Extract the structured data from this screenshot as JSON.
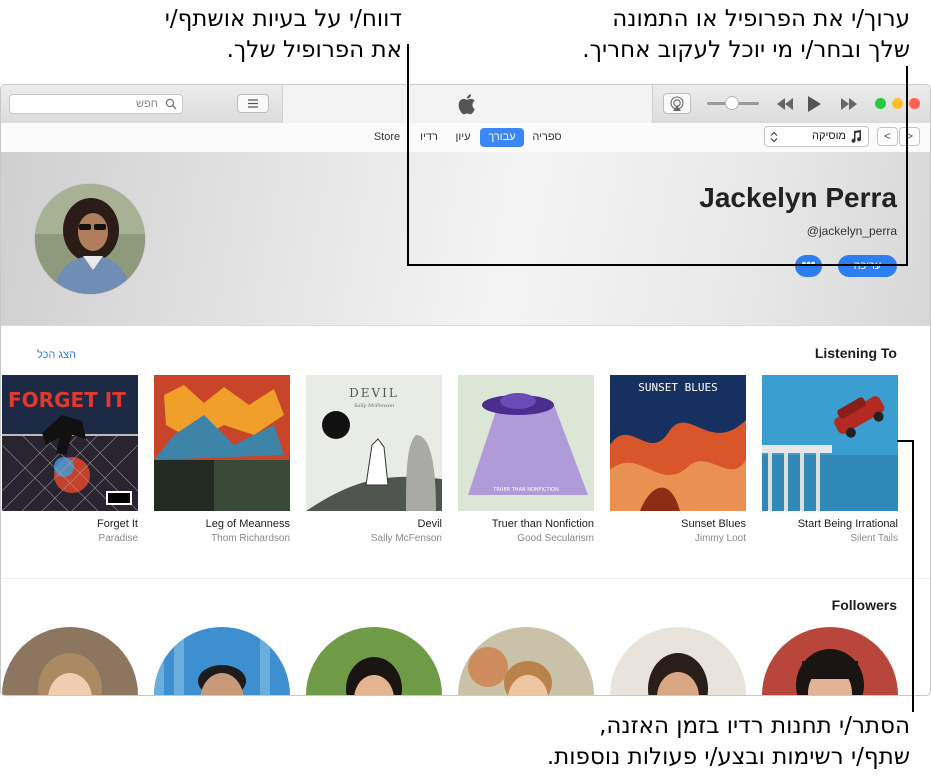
{
  "callouts": {
    "top_left": [
      "דווח/י על בעיות אושתף/י",
      "את הפרופיל שלך."
    ],
    "top_right": [
      "ערוך/י את הפרופיל או התמונה",
      "שלך ובחר/י מי יוכל לעקוב אחריך."
    ],
    "bottom": [
      "הסתר/י תחנות רדיו בזמן האזנה,",
      "שתף/י רשימות ובצע/י פעולות נוספות."
    ]
  },
  "toolbar": {
    "search_placeholder": "חפש"
  },
  "nav": {
    "tabs": [
      {
        "label": "Store",
        "active": false
      },
      {
        "label": "רדיו",
        "active": false
      },
      {
        "label": "עיון",
        "active": false
      },
      {
        "label": "עבורך",
        "active": true
      },
      {
        "label": "ספריה",
        "active": false
      }
    ],
    "media_picker": "מוסיקה",
    "back": "<",
    "forward": ">"
  },
  "profile": {
    "name": "Jackelyn Perra",
    "handle": "@jackelyn_perra",
    "edit_label": "עריכה",
    "more_label": "•••"
  },
  "listening": {
    "title": "Listening To",
    "see_all": "הצג הכל",
    "albums": [
      {
        "title": "Start Being Irrational",
        "artist": "Silent Tails"
      },
      {
        "title": "Sunset Blues",
        "artist": "Jimmy Loot",
        "cover_text": "SUNSET BLUES"
      },
      {
        "title": "Truer than Nonfiction",
        "artist": "Good Secularism",
        "cover_text": "TRUER THAN NONFICTION"
      },
      {
        "title": "Devil",
        "artist": "Sally McFenson",
        "cover_text": "DEVIL",
        "cover_subtext": "Sally McFenson"
      },
      {
        "title": "Leg of Meanness",
        "artist": "Thom Richardson"
      },
      {
        "title": "Forget It",
        "artist": "Paradise",
        "cover_text": "FORGET IT"
      }
    ]
  },
  "followers": {
    "title": "Followers"
  },
  "colors": {
    "accent": "#2d7ef0",
    "close": "#fe5f57",
    "minimize": "#febc2e",
    "zoom": "#28c840"
  }
}
